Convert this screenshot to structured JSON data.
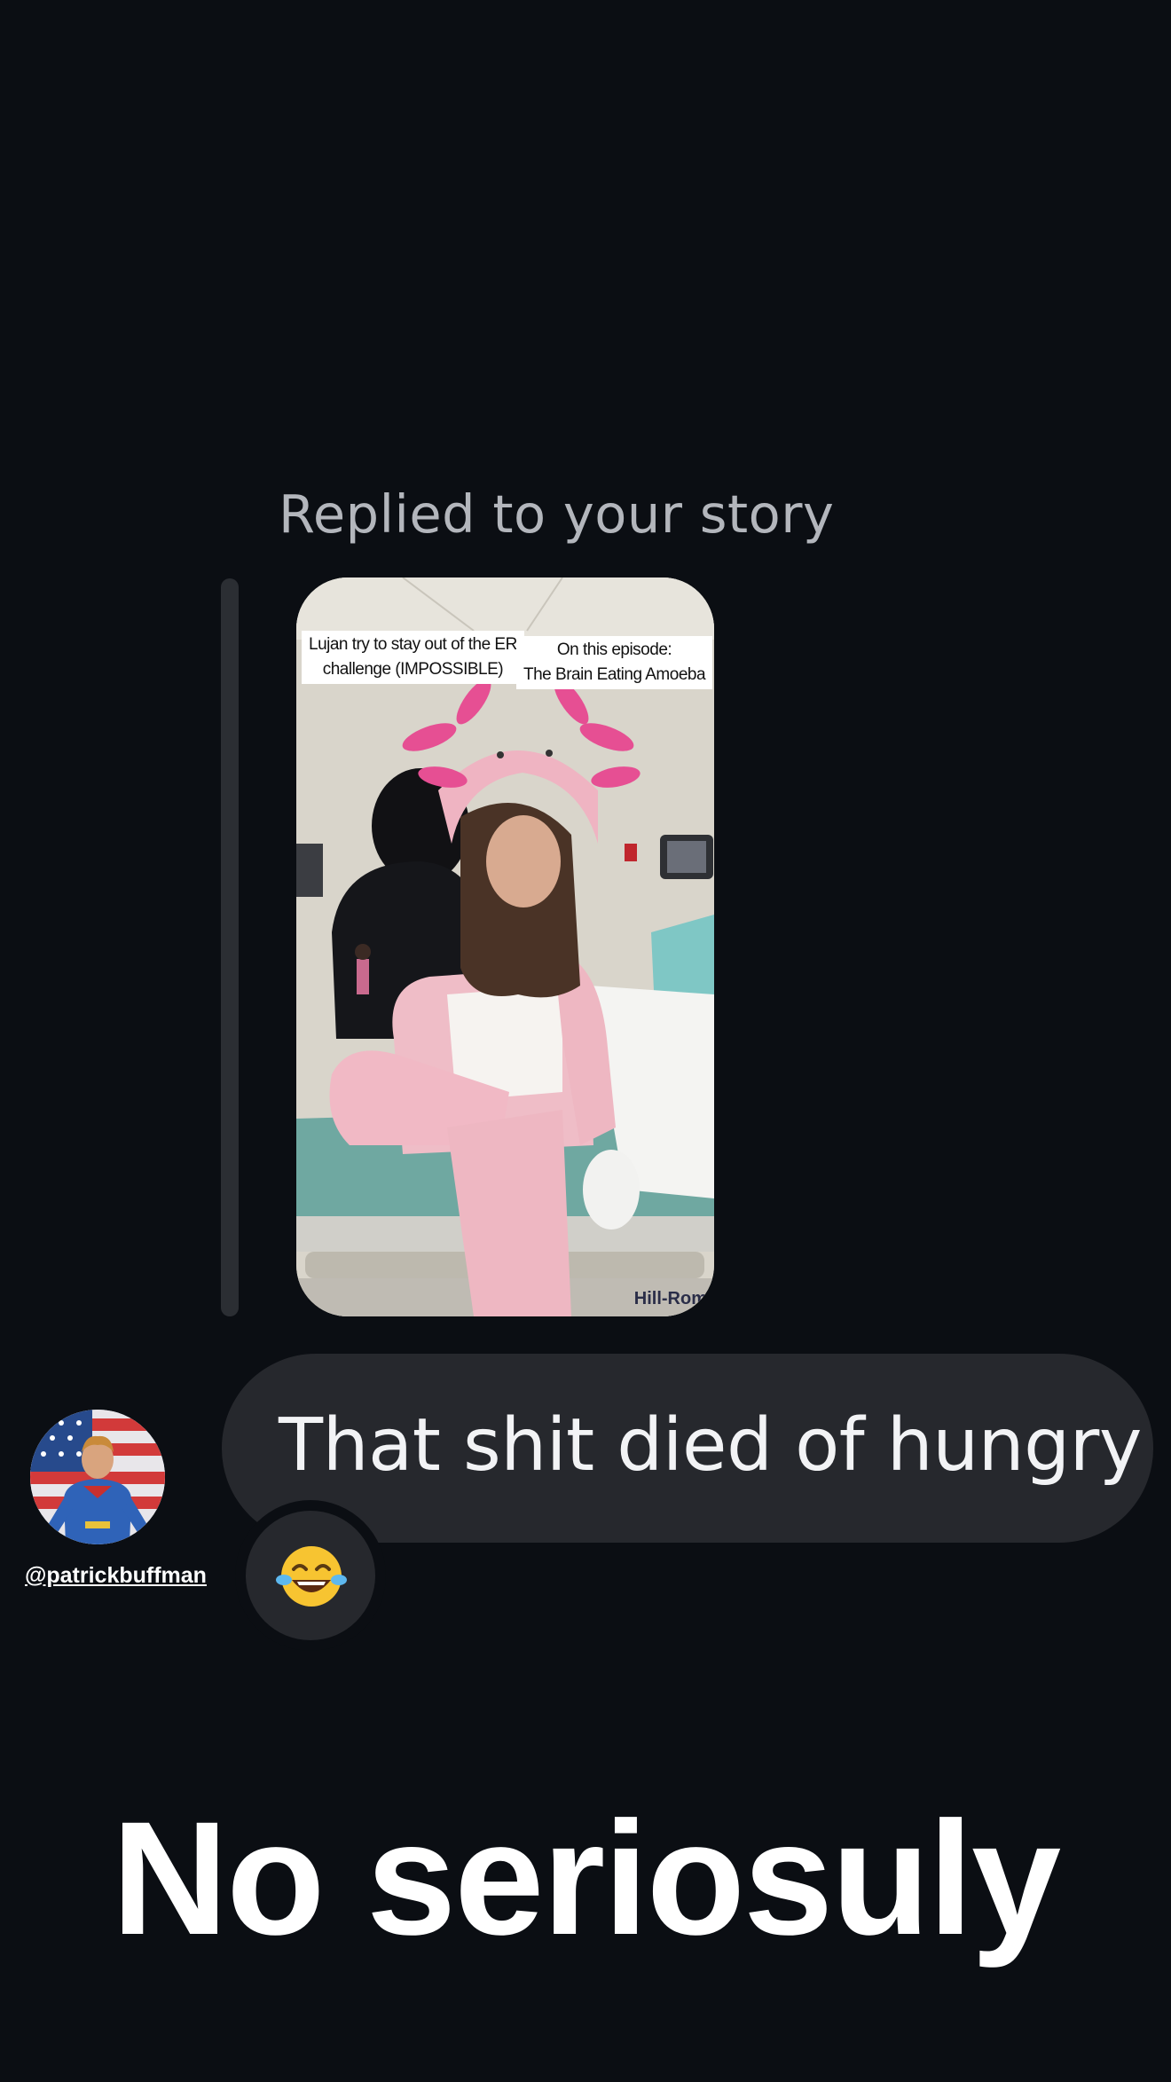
{
  "reply": {
    "label": "Replied to your story"
  },
  "story": {
    "caption_left_line1": "Lujan try to stay out of the ER",
    "caption_left_line2": "challenge (IMPOSSIBLE)",
    "caption_right_line1": "On this episode:",
    "caption_right_line2": "The Brain Eating Amoeba",
    "watermark": "Hill-Rom"
  },
  "message": {
    "text": "That shit died of hungry",
    "reaction_emoji": "laughing-crying-emoji"
  },
  "sender": {
    "handle": "@patrickbuffman",
    "avatar": "superhero-avatar"
  },
  "overlay": {
    "caption": "No seriosuly"
  }
}
